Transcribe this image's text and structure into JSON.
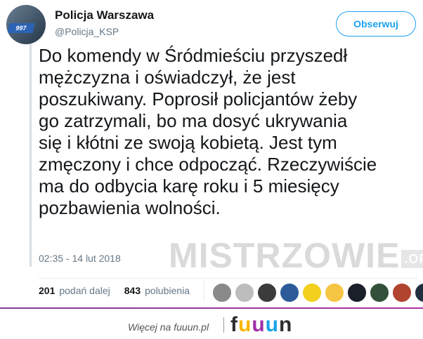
{
  "author": {
    "name": "Policja Warszawa",
    "handle": "@Policja_KSP",
    "avatar_badge": "997"
  },
  "follow_button": {
    "label": "Obserwuj"
  },
  "tweet": {
    "lines": [
      "Do komendy w Śródmieściu przyszedł",
      "mężczyzna i oświadczył, że jest",
      "poszukiwany. Poprosił policjantów żeby",
      "go zatrzymali, bo ma dosyć ukrywania",
      "się i kłótni ze swoją kobietą. Jest tym",
      "zmęczony i chce odpocząć. Rzeczywiście",
      "ma do odbycia karę roku i 5 miesięcy",
      "pozbawienia wolności."
    ],
    "timestamp": "02:35 - 14 lut 2018"
  },
  "watermark": {
    "main": "MISTRZOWIE",
    "org": ".ORG"
  },
  "stats": {
    "retweets_count": "201",
    "retweets_label": "podań dalej",
    "likes_count": "843",
    "likes_label": "polubienia"
  },
  "likers": [
    {
      "color": "#8a8a8a"
    },
    {
      "color": "#bdbdbd"
    },
    {
      "color": "#3b3b3b"
    },
    {
      "color": "#2d5b9a"
    },
    {
      "color": "#f2d01e"
    },
    {
      "color": "#f6c543"
    },
    {
      "color": "#1a1f2a"
    },
    {
      "color": "#33513a"
    },
    {
      "color": "#b0442e"
    },
    {
      "color": "#222f3f"
    }
  ],
  "footer": {
    "text": "Więcej na fuuun.pl",
    "logo": {
      "f": "f",
      "u1": "u",
      "u2": "u",
      "u3": "u",
      "n": "n"
    }
  },
  "colors": {
    "accent": "#1da1f2",
    "muted": "#657786",
    "footer_line": "#a030a8"
  }
}
